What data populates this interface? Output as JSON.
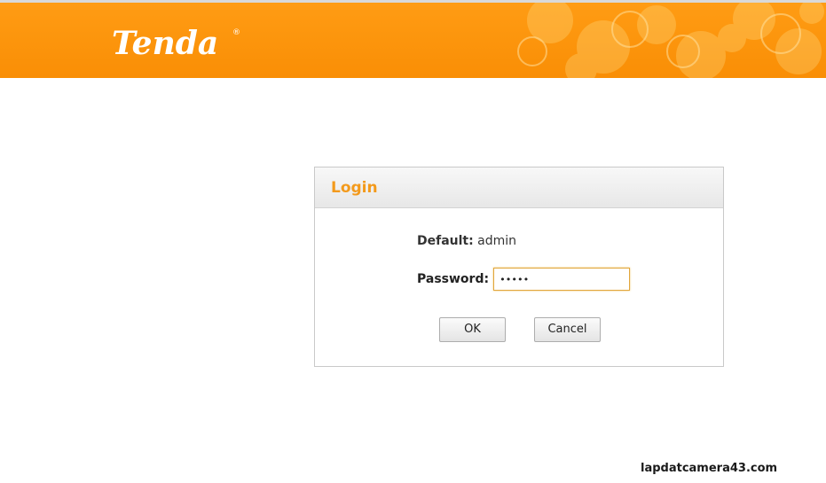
{
  "header": {
    "logo_text": "Tenda",
    "colors": {
      "primary": "#f98e05",
      "accent": "#ffc94a"
    }
  },
  "login": {
    "title": "Login",
    "default_label": "Default:",
    "default_value": "admin",
    "password_label": "Password:",
    "password_value": "admin",
    "ok_label": "OK",
    "cancel_label": "Cancel",
    "colors": {
      "title": "#f39a1c",
      "input_border": "#e1a63c"
    }
  },
  "watermark": {
    "text": "lapdatcamera43.com"
  }
}
